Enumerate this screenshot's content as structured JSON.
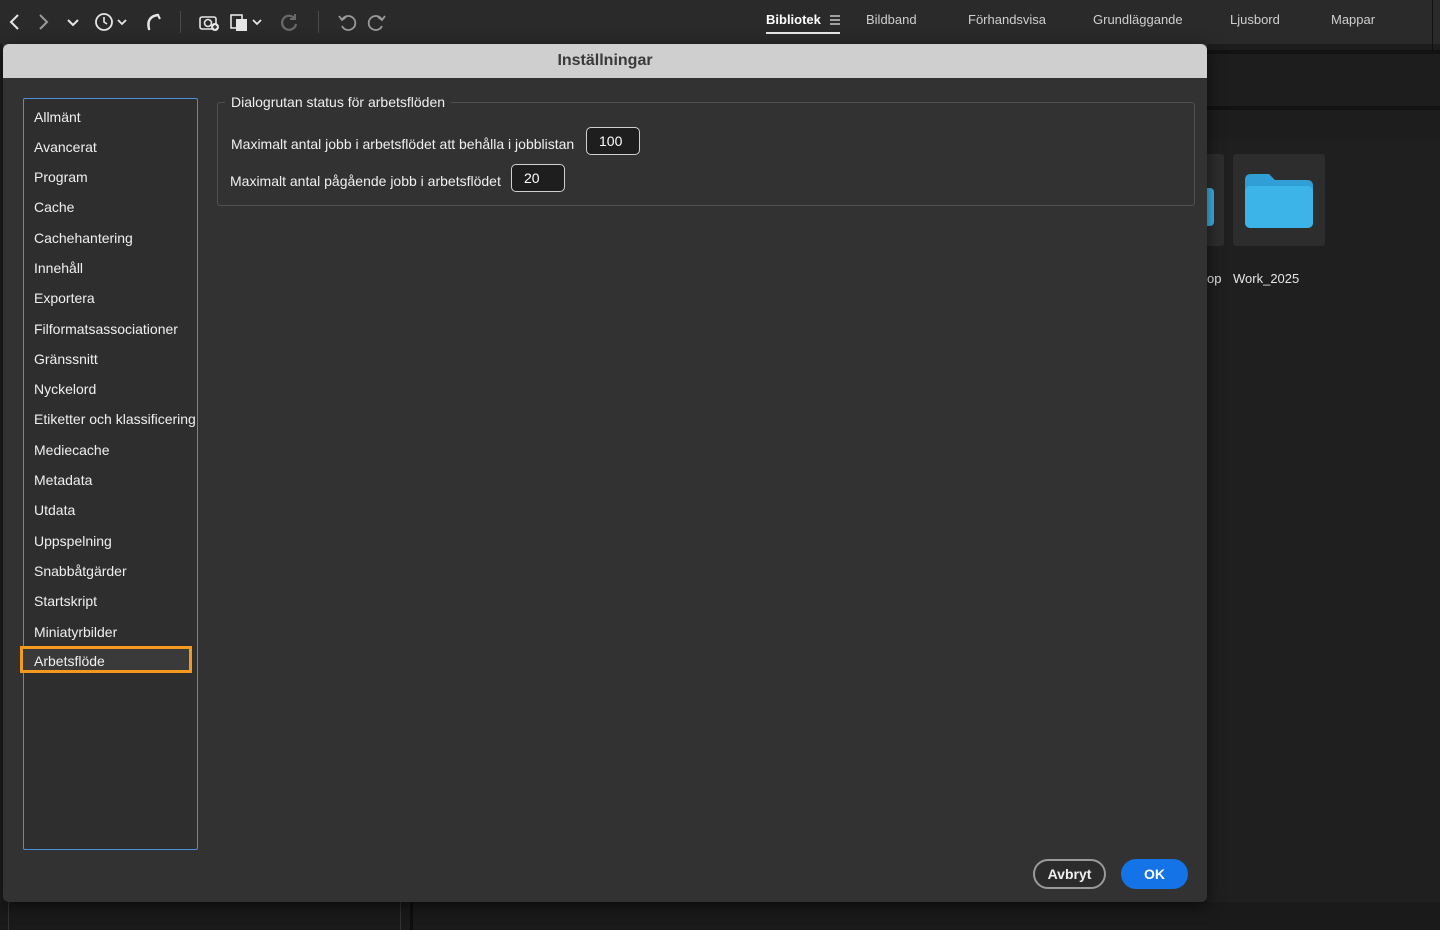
{
  "toolbar": {
    "icons": [
      "back-arrow-icon",
      "forward-arrow-icon",
      "chevron-down-icon",
      "history-icon",
      "boomerang-icon",
      "camera-import-icon",
      "copy-icon",
      "refresh-icon",
      "undo-icon",
      "redo-icon"
    ],
    "workspaces": [
      "Bibliotek",
      "Bildband",
      "Förhandsvisa",
      "Grundläggande",
      "Ljusbord",
      "Mappar"
    ],
    "active_workspace": "Bibliotek"
  },
  "background": {
    "folders": [
      {
        "label": "op"
      },
      {
        "label": "Work_2025"
      }
    ],
    "folder_color": "#3cb4e8"
  },
  "dialog": {
    "title": "Inställningar",
    "nav": [
      "Allmänt",
      "Avancerat",
      "Program",
      "Cache",
      "Cachehantering",
      "Innehåll",
      "Exportera",
      "Filformatsassociationer",
      "Gränssnitt",
      "Nyckelord",
      "Etiketter och klassificering",
      "Mediecache",
      "Metadata",
      "Utdata",
      "Uppspelning",
      "Snabbåtgärder",
      "Startskript",
      "Miniatyrbilder",
      "Arbetsflöde"
    ],
    "selected": "Arbetsflöde",
    "group": {
      "title": "Dialogrutan status för arbetsflöden",
      "max_jobs_label": "Maximalt antal jobb i arbetsflödet att behålla i jobblistan",
      "max_jobs_value": "100",
      "max_running_label": "Maximalt antal pågående jobb i arbetsflödet",
      "max_running_value": "20"
    },
    "cancel_label": "Avbryt",
    "ok_label": "OK"
  },
  "colors": {
    "accent": "#1473e6",
    "highlight": "#f39a1e",
    "list_border": "#4a8fd9"
  }
}
